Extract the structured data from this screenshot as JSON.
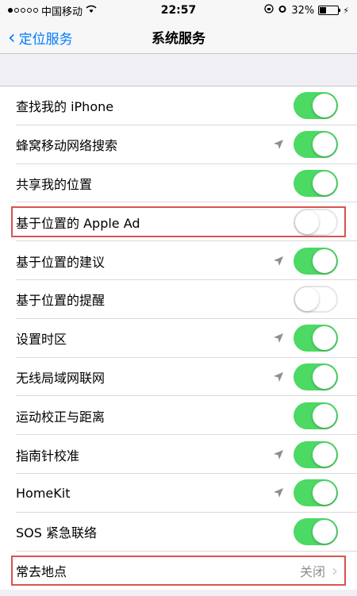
{
  "status_bar": {
    "carrier": "中国移动",
    "time": "22:57",
    "battery": "32%",
    "battery_level": 0.32
  },
  "nav": {
    "back_label": "定位服务",
    "title": "系统服务"
  },
  "rows": [
    {
      "label": "查找我的 iPhone",
      "toggle": "on",
      "arrow": false
    },
    {
      "label": "蜂窝移动网络搜索",
      "toggle": "on",
      "arrow": true
    },
    {
      "label": "共享我的位置",
      "toggle": "on",
      "arrow": false
    },
    {
      "label": "基于位置的 Apple Ad",
      "toggle": "off",
      "arrow": false,
      "highlighted": true
    },
    {
      "label": "基于位置的建议",
      "toggle": "on",
      "arrow": true
    },
    {
      "label": "基于位置的提醒",
      "toggle": "off",
      "arrow": false
    },
    {
      "label": "设置时区",
      "toggle": "on",
      "arrow": true
    },
    {
      "label": "无线局域网联网",
      "toggle": "on",
      "arrow": true
    },
    {
      "label": "运动校正与距离",
      "toggle": "on",
      "arrow": false
    },
    {
      "label": "指南针校准",
      "toggle": "on",
      "arrow": true
    },
    {
      "label": "HomeKit",
      "toggle": "on",
      "arrow": true
    },
    {
      "label": "SOS 紧急联络",
      "toggle": "on",
      "arrow": false
    },
    {
      "label": "常去地点",
      "value": "关闭",
      "highlighted": true
    }
  ],
  "colors": {
    "accent": "#007aff",
    "toggle_on": "#4cd964",
    "highlight": "#d9534f"
  }
}
